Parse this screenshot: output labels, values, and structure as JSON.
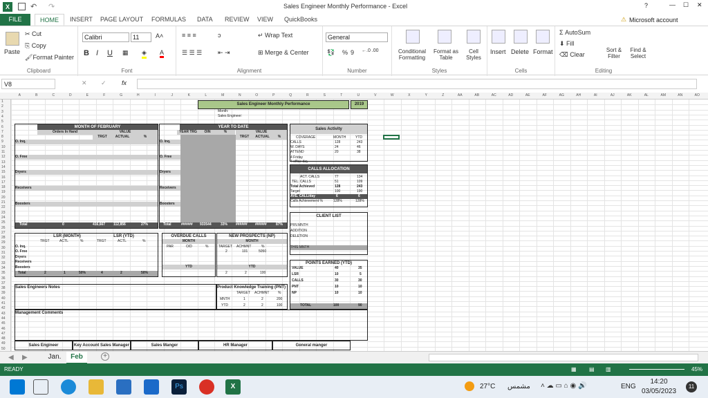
{
  "window": {
    "title": "Sales Engineer Monthly  Performance - Excel",
    "help": "?",
    "min": "—",
    "max": "☐",
    "close": "✕"
  },
  "tabs": [
    "FILE",
    "HOME",
    "INSERT",
    "PAGE LAYOUT",
    "FORMULAS",
    "DATA",
    "REVIEW",
    "VIEW",
    "QuickBooks"
  ],
  "account": "Microsoft account",
  "ribbon": {
    "clipboard": {
      "paste": "Paste",
      "cut": "Cut",
      "copy": "Copy",
      "painter": "Format Painter",
      "label": "Clipboard"
    },
    "font": {
      "name": "Calibri",
      "size": "11",
      "label": "Font",
      "bold": "B",
      "italic": "I",
      "underline": "U"
    },
    "alignment": {
      "wrap": "Wrap Text",
      "merge": "Merge & Center",
      "label": "Alignment"
    },
    "number": {
      "format": "General",
      "label": "Number",
      "pct": "%",
      "comma": "9"
    },
    "styles": {
      "cond": "Conditional Formatting",
      "table": "Format as Table",
      "cell": "Cell Styles",
      "label": "Styles"
    },
    "cells": {
      "insert": "Insert",
      "delete": "Delete",
      "format": "Format",
      "label": "Cells"
    },
    "editing": {
      "autosum": "AutoSum",
      "fill": "Fill",
      "clear": "Clear",
      "sort": "Sort & Filter",
      "find": "Find & Select",
      "label": "Editing"
    }
  },
  "formula": {
    "namebox": "V8",
    "fx": "fx",
    "value": ""
  },
  "cols": [
    "A",
    "B",
    "C",
    "D",
    "E",
    "F",
    "G",
    "H",
    "I",
    "J",
    "K",
    "L",
    "M",
    "N",
    "O",
    "P",
    "Q",
    "R",
    "S",
    "T",
    "U",
    "V",
    "W",
    "X",
    "Y",
    "Z",
    "AA",
    "AB",
    "AC",
    "AD",
    "AE",
    "AF",
    "AG",
    "AH",
    "AI",
    "AJ",
    "AK",
    "AL",
    "AM",
    "AN",
    "AO"
  ],
  "report": {
    "title": "Sales Engineer Monthly Performance",
    "year": "2019",
    "month_label": "Month:",
    "se_label": "Sales Engineer:",
    "feb": {
      "header": "MONTH OF FEBRUARY",
      "orders": "Orders In Hand",
      "value": "VALUE",
      "trgt": "TRGT",
      "actual": "ACTUAL",
      "pct": "%"
    },
    "ytd": {
      "header": "YEAR TO DATE",
      "yeartrg": "YEAR TRG",
      "oin": "OIN",
      "pct": "%",
      "value": "VALUE",
      "trgt": "TRGT",
      "actual": "ACTUAL",
      "pct2": "%"
    },
    "rows": [
      "O. Inq.",
      "O. Free",
      "Dryers",
      "Receivers",
      "Boosters"
    ],
    "total": {
      "label": "Total",
      "oin": "0",
      "trgt": "416,667",
      "actual": "112,856",
      "pct": "27%",
      "ytd_a": "######",
      "ytd_b": "933544",
      "ytd_pct": "33%",
      "ytd_c": "######",
      "ytd_d": "######",
      "ytd_e": "87%"
    },
    "activity": {
      "title": "Sales Activity",
      "coverage": "COVERAGE",
      "month": "MONTH",
      "ytd": "YTD",
      "calls": "CALLS",
      "calls_m": "128",
      "calls_y": "243",
      "wdays": "W. DAYS",
      "wdays_m": "24",
      "wdays_y": "46",
      "attend": "ATTEND",
      "attend_m": "20",
      "attend_y": "38",
      "note1": "4 Friday",
      "note2": "4 office day"
    },
    "alloc": {
      "title": "CALLS ALLOCATION",
      "act": "ACT. CALLS",
      "act_m": "77",
      "act_y": "134",
      "tel": "TEL. CALLS",
      "tel_m": "51",
      "tel_y": "109",
      "ta": "Total Achieved",
      "ta_m": "128",
      "ta_y": "243",
      "target": "Target",
      "target_m": "100",
      "target_y": "190",
      "ave": "AVE. CALL/day",
      "ave_m": "6",
      "ave_y": "6",
      "ach": "Calls Achievement %",
      "ach_m": "128%",
      "ach_y": "128%"
    },
    "client": {
      "title": "CLIENT LIST",
      "prv": "PRV.MNTH",
      "add": "ADDITION",
      "del": "DELETION",
      "this": "THIS MNTH"
    },
    "lsr": {
      "m": "LSR (MONTH)",
      "y": "LSR (YTD)",
      "trgt": "TRGT",
      "actl": "ACTL",
      "pct": "%",
      "rows": [
        "O. Inq.",
        "O. Free",
        "Dryers",
        "Receivers",
        "Boosters"
      ],
      "total": "Total",
      "tm1": "2",
      "tm2": "1",
      "tm3": "50%",
      "ty1": "4",
      "ty2": "2",
      "ty3": "50%"
    },
    "overdue": {
      "title": "OVERDUE CALLS",
      "month": "MONTH",
      "par": "PAR",
      "od": "O/D",
      "pct": "%",
      "ytd": "YTD"
    },
    "np": {
      "title": "NEW PROSPECTS (NP)",
      "month": "MONTH",
      "target": "TARGET",
      "achmnt": "ACHMNT",
      "pct": "%",
      "m1": "2",
      "m2": "101",
      "m3": "5050",
      "ytd": "YTD",
      "y1": "2",
      "y2": "2",
      "y3": "100"
    },
    "points": {
      "title": "POINTS EARNED (YTD)",
      "value": "VALUE",
      "rows": [
        [
          "LSR",
          "10",
          "5"
        ],
        [
          "CALLS",
          "30",
          "30"
        ],
        [
          "PNT",
          "10",
          "10"
        ],
        [
          "NP",
          "10",
          "10"
        ]
      ],
      "v0": "40",
      "v1": "35",
      "total": "TOTAL",
      "t1": "100",
      "t2": "90"
    },
    "notes": "Sales Engineers Notes",
    "knowledge": "Product Knowledge Training (PNT)",
    "k_target": "TARGET",
    "k_ach": "ACHMNT",
    "k_pct": "%",
    "mnth": "MNTH",
    "mnth_v": [
      "1",
      "2",
      "200"
    ],
    "ytdk": "YTD",
    "ytd_v": [
      "2",
      "2",
      "100"
    ],
    "mgmt": "Management Comments",
    "sign": [
      "Sales Engineer",
      "Key Account Sales Manager",
      "Sales Manger",
      "HR Manager",
      "General manger"
    ]
  },
  "sheets": [
    "Jan.",
    "Feb"
  ],
  "status": {
    "ready": "READY",
    "zoom": "45%"
  },
  "taskbar": {
    "temp": "27°C",
    "weather": "مشمس",
    "lang": "ENG",
    "time": "14:20",
    "date": "03/05/2023",
    "notif": "11"
  }
}
